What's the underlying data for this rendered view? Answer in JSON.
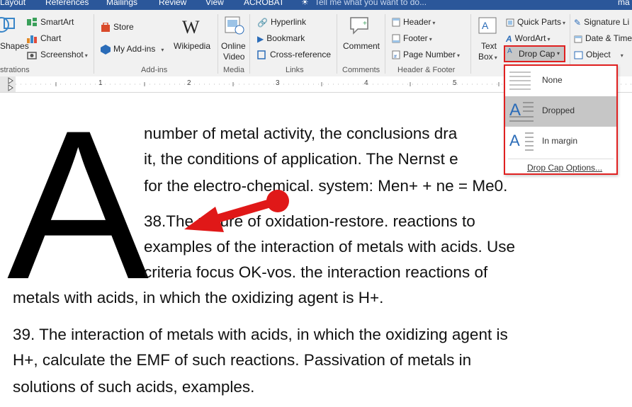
{
  "tabs": {
    "layout": "Layout",
    "references": "References",
    "mailings": "Mailings",
    "review": "Review",
    "view": "View",
    "acrobat": "ACROBAT",
    "tell": "Tell me what you want to do...",
    "user": "ma"
  },
  "ribbon": {
    "shapes": "Shapes",
    "smartart": "SmartArt",
    "chart": "Chart",
    "screenshot": "Screenshot",
    "store": "Store",
    "myaddins": "My Add-ins",
    "wikipedia": "Wikipedia",
    "online_video_1": "Online",
    "online_video_2": "Video",
    "hyperlink": "Hyperlink",
    "bookmark": "Bookmark",
    "crossref": "Cross-reference",
    "comment": "Comment",
    "header": "Header",
    "footer": "Footer",
    "page_number": "Page Number",
    "textbox_1": "Text",
    "textbox_2": "Box",
    "quick_parts": "Quick Parts",
    "wordart": "WordArt",
    "drop_cap": "Drop Cap",
    "signature": "Signature Li",
    "datetime": "Date & Time",
    "object": "Object",
    "groups": {
      "illustrations": "strations",
      "addins": "Add-ins",
      "media": "Media",
      "links": "Links",
      "comments": "Comments",
      "header_footer": "Header & Footer"
    }
  },
  "ruler": {
    "n1": "1",
    "n2": "2",
    "n3": "3",
    "n4": "4",
    "n5": "5"
  },
  "dropcap_menu": {
    "none": "None",
    "dropped": "Dropped",
    "in_margin": "In margin",
    "options": "Drop Cap Options..."
  },
  "document": {
    "dropcap_letter": "A",
    "lines": [
      " number of metal activity, the conclusions dra",
      "it, the conditions of application. The Nernst e",
      "for the electro-chemical. system: Men+ + ne = Me0.",
      "38.The nature of oxidation-restore. reactions to",
      "examples of the interaction of metals with acids. Use",
      "criteria focus OK-vos. the interaction reactions of",
      "metals with acids, in which the oxidizing agent is H+.",
      "39. The interaction of metals with acids, in which the oxidizing agent is",
      "H+, calculate the EMF of such reactions. Passivation of metals in",
      "solutions of such acids, examples."
    ]
  },
  "colors": {
    "accent": "#2b579a",
    "highlight": "#e02020",
    "arrow": "#e01818"
  }
}
